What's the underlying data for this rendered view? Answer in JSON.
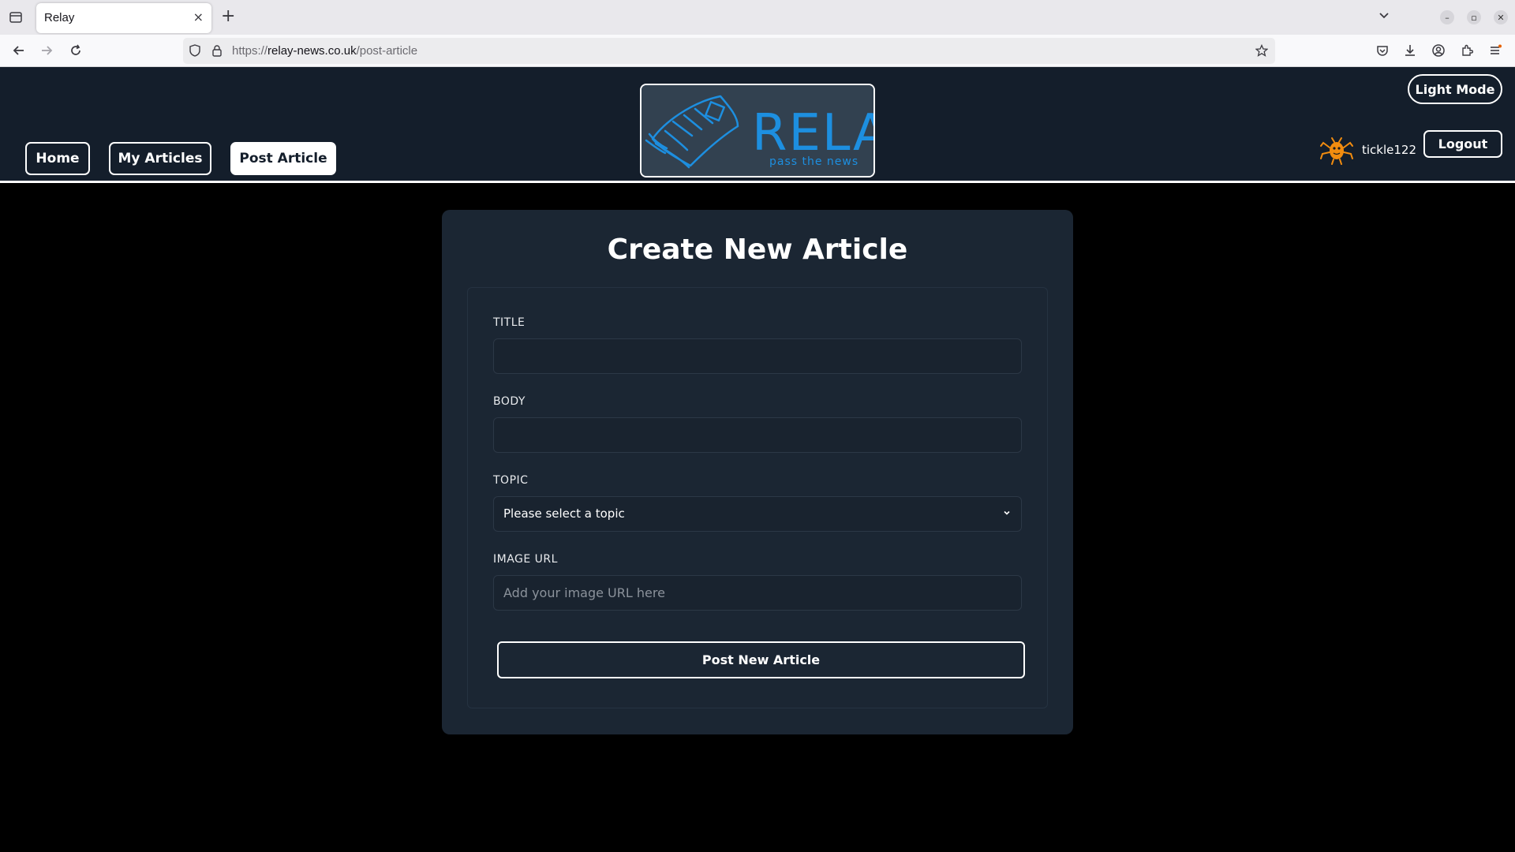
{
  "browser": {
    "tab_title": "Relay",
    "tab_close": "×",
    "new_tab": "+",
    "url_scheme": "https://",
    "url_host": "relay-news.co.uk",
    "url_path": "/post-article",
    "window_buttons": [
      "–",
      "▫",
      "✕"
    ]
  },
  "header": {
    "nav": [
      {
        "label": "Home",
        "active": false
      },
      {
        "label": "My Articles",
        "active": false
      },
      {
        "label": "Post Article",
        "active": true
      }
    ],
    "logo": {
      "text": "RELAY",
      "tagline": "pass the news"
    },
    "light_mode_label": "Light Mode",
    "username": "tickle122",
    "logout_label": "Logout"
  },
  "form": {
    "title": "Create New Article",
    "title_label": "TITLE",
    "title_value": "",
    "body_label": "BODY",
    "body_value": "",
    "topic_label": "TOPIC",
    "topic_selected": "Please select a topic",
    "image_label": "IMAGE URL",
    "image_placeholder": "Add your image URL here",
    "submit_label": "Post New Article"
  },
  "colors": {
    "page_bg": "#000000",
    "header_bg": "#141e2b",
    "card_bg": "#1b2633",
    "logo_blue": "#1d8fe0",
    "avatar_orange": "#f28c0f"
  }
}
